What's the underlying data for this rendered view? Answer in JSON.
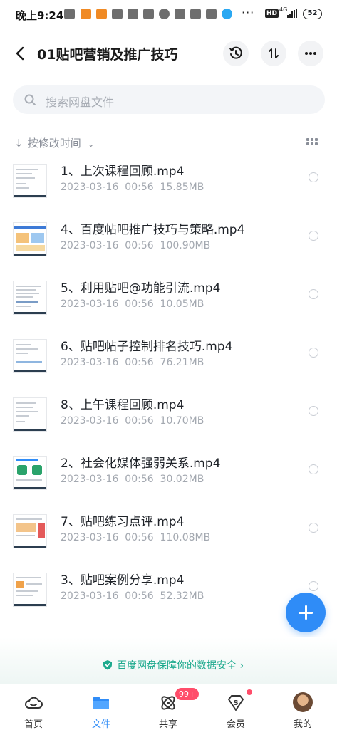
{
  "status_bar": {
    "time": "晚上9:24",
    "network": "4G",
    "battery": "52",
    "hd": "HD",
    "more": "···"
  },
  "header": {
    "title": "01贴吧营销及推广技巧"
  },
  "search": {
    "placeholder": "搜索网盘文件"
  },
  "sort": {
    "label": "按修改时间"
  },
  "files": [
    {
      "name": "1、上次课程回顾.mp4",
      "date": "2023-03-16",
      "time": "00:56",
      "size": "15.85MB"
    },
    {
      "name": "4、百度帖吧推广技巧与策略.mp4",
      "date": "2023-03-16",
      "time": "00:56",
      "size": "100.90MB"
    },
    {
      "name": "5、利用贴吧@功能引流.mp4",
      "date": "2023-03-16",
      "time": "00:56",
      "size": "10.05MB"
    },
    {
      "name": "6、贴吧帖子控制排名技巧.mp4",
      "date": "2023-03-16",
      "time": "00:56",
      "size": "76.21MB"
    },
    {
      "name": "8、上午课程回顾.mp4",
      "date": "2023-03-16",
      "time": "00:56",
      "size": "10.70MB"
    },
    {
      "name": "2、社会化媒体强弱关系.mp4",
      "date": "2023-03-16",
      "time": "00:56",
      "size": "30.02MB"
    },
    {
      "name": "7、贴吧练习点评.mp4",
      "date": "2023-03-16",
      "time": "00:56",
      "size": "110.08MB"
    },
    {
      "name": "3、贴吧案例分享.mp4",
      "date": "2023-03-16",
      "time": "00:56",
      "size": "52.32MB"
    }
  ],
  "security": {
    "text": "百度网盘保障你的数据安全",
    "arrow": "›"
  },
  "nav": {
    "tabs": [
      {
        "label": "首页",
        "icon": "home-cloud-icon"
      },
      {
        "label": "文件",
        "icon": "folder-icon"
      },
      {
        "label": "共享",
        "icon": "share-icon"
      },
      {
        "label": "会员",
        "icon": "member-icon"
      },
      {
        "label": "我的",
        "icon": "avatar"
      }
    ],
    "share_badge": "99+"
  },
  "colors": {
    "accent": "#2f8cf7",
    "secure": "#1eaa8e",
    "badge": "#ff4d6a"
  }
}
